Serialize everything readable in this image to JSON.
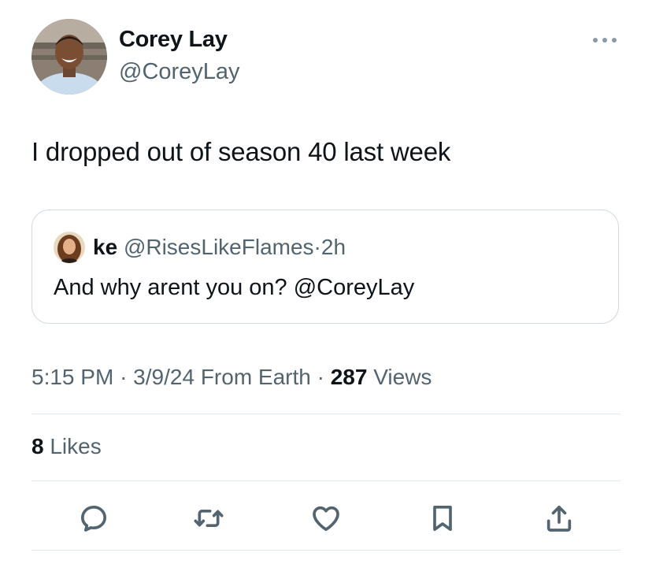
{
  "author": {
    "name": "Corey Lay",
    "handle": "@CoreyLay"
  },
  "tweet": {
    "text": "I dropped out of season 40 last week"
  },
  "quoted": {
    "name": "ke",
    "handle": "@RisesLikeFlames",
    "separator": "·",
    "time": "2h",
    "text": "And why arent you on? @CoreyLay"
  },
  "meta": {
    "time": "5:15 PM",
    "sep1": "·",
    "date": "3/9/24",
    "source": "From Earth",
    "sep2": "·",
    "views_count": "287",
    "views_label": "Views"
  },
  "likes": {
    "count": "8",
    "label": "Likes"
  },
  "icons": {
    "more": "more-horizontal-icon",
    "reply": "reply-icon",
    "retweet": "retweet-icon",
    "like": "heart-icon",
    "bookmark": "bookmark-icon",
    "share": "share-icon"
  },
  "colors": {
    "text": "#0f1419",
    "secondary": "#536471",
    "border": "#cfd9de"
  }
}
